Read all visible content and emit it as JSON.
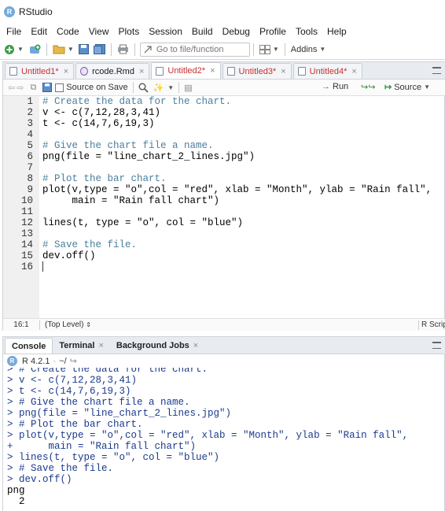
{
  "window": {
    "title": "RStudio"
  },
  "menubar": [
    "File",
    "Edit",
    "Code",
    "View",
    "Plots",
    "Session",
    "Build",
    "Debug",
    "Profile",
    "Tools",
    "Help"
  ],
  "toolbar": {
    "goto_placeholder": "Go to file/function",
    "addins_label": "Addins"
  },
  "editor": {
    "tabs": [
      {
        "label": "Untitled1*",
        "active": false,
        "icon": "r-script-icon"
      },
      {
        "label": "rcode.Rmd",
        "active": false,
        "icon": "rmarkdown-icon"
      },
      {
        "label": "Untitled2*",
        "active": true,
        "icon": "r-script-icon"
      },
      {
        "label": "Untitled3*",
        "active": false,
        "icon": "r-script-icon"
      },
      {
        "label": "Untitled4*",
        "active": false,
        "icon": "r-script-icon"
      }
    ],
    "source_on_save_label": "Source on Save",
    "run_label": "Run",
    "source_label": "Source",
    "lines": [
      "# Create the data for the chart.",
      "v <- c(7,12,28,3,41)",
      "t <- c(14,7,6,19,3)",
      "",
      "# Give the chart file a name.",
      "png(file = \"line_chart_2_lines.jpg\")",
      "",
      "# Plot the bar chart.",
      "plot(v,type = \"o\",col = \"red\", xlab = \"Month\", ylab = \"Rain fall\",",
      "     main = \"Rain fall chart\")",
      "",
      "lines(t, type = \"o\", col = \"blue\")",
      "",
      "# Save the file.",
      "dev.off()",
      ""
    ],
    "line_numbers": [
      "1",
      "2",
      "3",
      "4",
      "5",
      "6",
      "7",
      "8",
      "9",
      "10",
      "11",
      "12",
      "13",
      "14",
      "15",
      "16"
    ],
    "status": {
      "position": "16:1",
      "scope": "(Top Level)",
      "filetype": "R Script"
    }
  },
  "console": {
    "tabs": [
      {
        "label": "Console",
        "active": true
      },
      {
        "label": "Terminal",
        "active": false
      },
      {
        "label": "Background Jobs",
        "active": false
      }
    ],
    "r_version": "R 4.2.1",
    "working_dir": "~/",
    "lines": [
      "> # Create the data for the chart.",
      "> v <- c(7,12,28,3,41)",
      "> t <- c(14,7,6,19,3)",
      "> # Give the chart file a name.",
      "> png(file = \"line_chart_2_lines.jpg\")",
      "> # Plot the bar chart.",
      "> plot(v,type = \"o\",col = \"red\", xlab = \"Month\", ylab = \"Rain fall\",",
      "+      main = \"Rain fall chart\")",
      "> lines(t, type = \"o\", col = \"blue\")",
      "> # Save the file.",
      "> dev.off()"
    ],
    "output": [
      "png",
      "  2"
    ]
  },
  "colors": {
    "comment": "#4a7f9c",
    "string": "#2a7f2a",
    "number": "#2f2fbf",
    "console_input": "#1a3a8c",
    "tab_modified": "#c73030"
  }
}
